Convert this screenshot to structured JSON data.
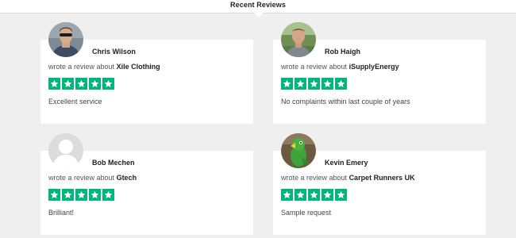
{
  "header": {
    "title": "Recent Reviews"
  },
  "review_template": {
    "action_text": "wrote a review about"
  },
  "colors": {
    "star_background": "#00b67a",
    "page_background": "#efefef",
    "card_background": "#ffffff"
  },
  "reviews": [
    {
      "name": "Chris Wilson",
      "company": "Xile Clothing",
      "rating": 5,
      "text": "Excellent service",
      "avatar": "photo-man-with-sunglasses"
    },
    {
      "name": "Rob Haigh",
      "company": "iSupplyEnergy",
      "rating": 5,
      "text": "No complaints within last couple of years",
      "avatar": "photo-man-outdoors"
    },
    {
      "name": "Bob Mechen",
      "company": "Gtech",
      "rating": 5,
      "text": "Brilliant!",
      "avatar": "default-user-silhouette"
    },
    {
      "name": "Kevin Emery",
      "company": "Carpet Runners UK",
      "rating": 5,
      "text": "Sample request",
      "avatar": "photo-green-parrot"
    }
  ]
}
